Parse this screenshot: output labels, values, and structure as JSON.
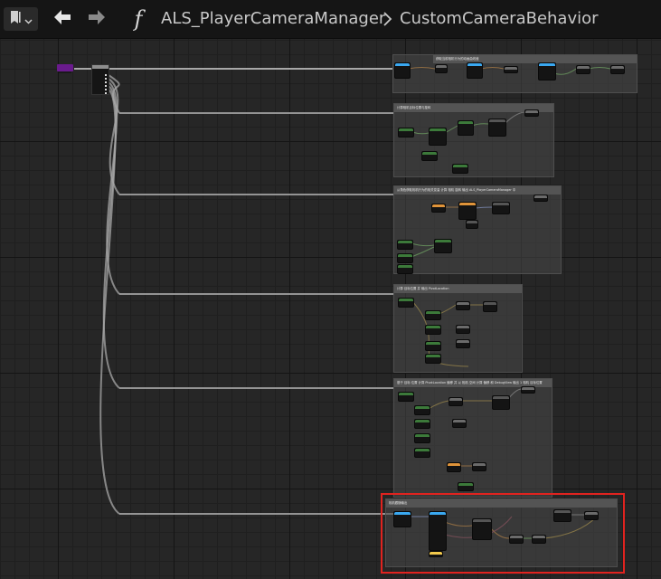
{
  "toolbar": {
    "breadcrumb_root": "ALS_PlayerCameraManager",
    "breadcrumb_separator": ">",
    "breadcrumb_current": "CustomCameraBehavior",
    "function_glyph": "f",
    "icons": [
      "bookmark-icon",
      "chevron-down-icon",
      "back-arrow-icon",
      "forward-arrow-icon",
      "function-icon"
    ]
  },
  "colors": {
    "background": "#262626",
    "toolbar": "#151515",
    "wire": "#a8a8a8",
    "exec_pin": "#ffffff",
    "entry_node": "#6a1b8d",
    "highlight": "#e0231f",
    "pin_float": "#7fd36a",
    "pin_vector": "#f2c94c",
    "pin_rotator": "#9db6ff",
    "pin_object": "#3aa8f0",
    "pin_struct": "#e0943a"
  },
  "graph": {
    "comment_boxes": [
      {
        "title": "获取当前相机行为的动画曲线值"
      },
      {
        "title": "计算相机目标位置与旋转"
      },
      {
        "title": "从角色获取相机行为的相关变量 计算 相机 旋转 输出 ALS_PlayerCameraManager 中"
      },
      {
        "title": "计算 目标位置 并 输出 PivotLocation"
      },
      {
        "title": "基于 目标 位置 计算 PivotLocation 偏移 并 以 相机 空间 计算 偏移 和 DebugView 输出 1 相机 目标位置"
      },
      {
        "title": "相机跟随输出"
      }
    ]
  }
}
